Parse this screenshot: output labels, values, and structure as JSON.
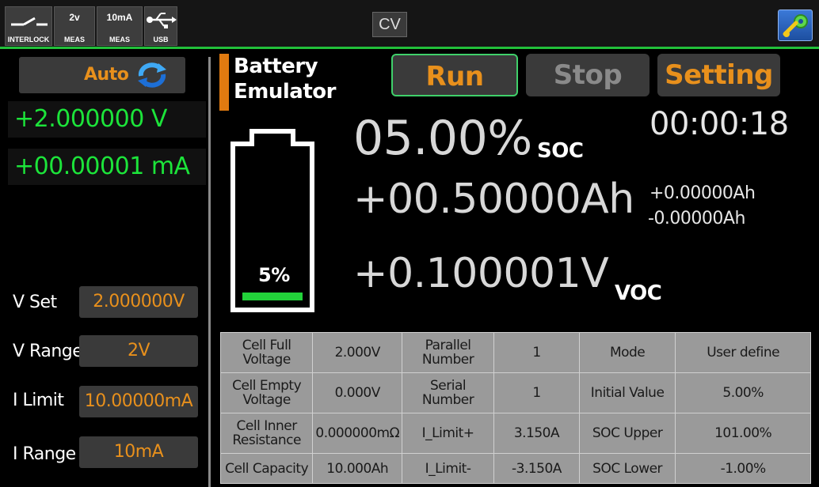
{
  "topbar": {
    "interlock_label": "INTERLOCK",
    "meas1_top": "2v",
    "meas1_label": "MEAS",
    "meas2_top": "10mA",
    "meas2_label": "MEAS",
    "usb_label": "USB",
    "mode": "CV",
    "status_color": "#22c03a"
  },
  "left": {
    "range_mode": "Auto",
    "voltage_reading": "+2.000000 V",
    "current_reading": "+00.00001 mA",
    "settings": [
      {
        "label": "V Set",
        "value": "2.000000V"
      },
      {
        "label": "V Range",
        "value": "2V"
      },
      {
        "label": "I Limit",
        "value": "10.00000mA"
      },
      {
        "label": "I Range",
        "value": "10mA"
      }
    ]
  },
  "main": {
    "title_line1": "Battery",
    "title_line2": "Emulator",
    "run_label": "Run",
    "stop_label": "Stop",
    "setting_label": "Setting",
    "elapsed": "00:00:18",
    "soc_value": "05.00%",
    "soc_label": "SOC",
    "capacity_value": "+00.50000Ah",
    "capacity_plus": "+0.00000Ah",
    "capacity_minus": "-0.00000Ah",
    "voc_value": "+0.100001V",
    "voc_label": "VOC",
    "battery_percent": "5%",
    "battery_level": 0.05
  },
  "params": [
    [
      "Cell Full Voltage",
      "2.000V",
      "Parallel Number",
      "1",
      "Mode",
      "User define"
    ],
    [
      "Cell Empty Voltage",
      "0.000V",
      "Serial Number",
      "1",
      "Initial Value",
      "5.00%"
    ],
    [
      "Cell Inner Resistance",
      "0.000000mΩ",
      "I_Limit+",
      "3.150A",
      "SOC Upper",
      "101.00%"
    ],
    [
      "Cell Capacity",
      "10.000Ah",
      "I_Limit-",
      "-3.150A",
      "SOC Lower",
      "-1.00%"
    ]
  ],
  "colors": {
    "accent": "#e8901c",
    "readout": "#1ce43a",
    "run_border": "#3fd06a"
  }
}
